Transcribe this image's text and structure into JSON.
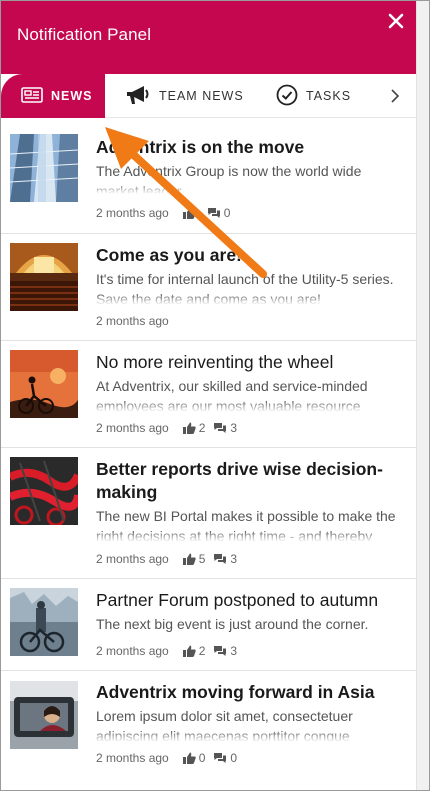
{
  "panel": {
    "title": "Notification Panel",
    "accent_color": "#c4074e",
    "annotation_color": "#f07a16"
  },
  "tabs": [
    {
      "label": "NEWS",
      "icon": "newspaper-icon",
      "active": true
    },
    {
      "label": "TEAM NEWS",
      "icon": "megaphone-icon",
      "active": false
    },
    {
      "label": "TASKS",
      "icon": "check-circle-icon",
      "active": false
    }
  ],
  "news": [
    {
      "title": "Adventrix is on the move",
      "description": "The Adventrix Group is now the world wide market leader",
      "time": "2 months ago",
      "likes": "",
      "comments": "0",
      "bold": true
    },
    {
      "title": "Come as you are!",
      "description": "It's time for internal launch of the Utility-5 series. Save the date and come as you are!",
      "time": "2 months ago",
      "likes": "",
      "comments": "",
      "bold": true
    },
    {
      "title": "No more reinventing the wheel",
      "description": "At Adventrix, our skilled and service-minded employees are our most valuable resource",
      "time": "2 months ago",
      "likes": "2",
      "comments": "3",
      "bold": false
    },
    {
      "title": "Better reports drive wise decision-making",
      "description": "The new BI Portal makes it possible to make the right decisions at the right time - and thereby",
      "time": "2 months ago",
      "likes": "5",
      "comments": "3",
      "bold": true
    },
    {
      "title": "Partner Forum postponed to autumn",
      "description": "The next big event is just around the corner.",
      "time": "2 months ago",
      "likes": "2",
      "comments": "3",
      "bold": false
    },
    {
      "title": "Adventrix moving forward in Asia",
      "description": "Lorem ipsum dolor sit amet, consectetuer adipiscing elit maecenas porttitor congue",
      "time": "2 months ago",
      "likes": "0",
      "comments": "0",
      "bold": true
    }
  ]
}
